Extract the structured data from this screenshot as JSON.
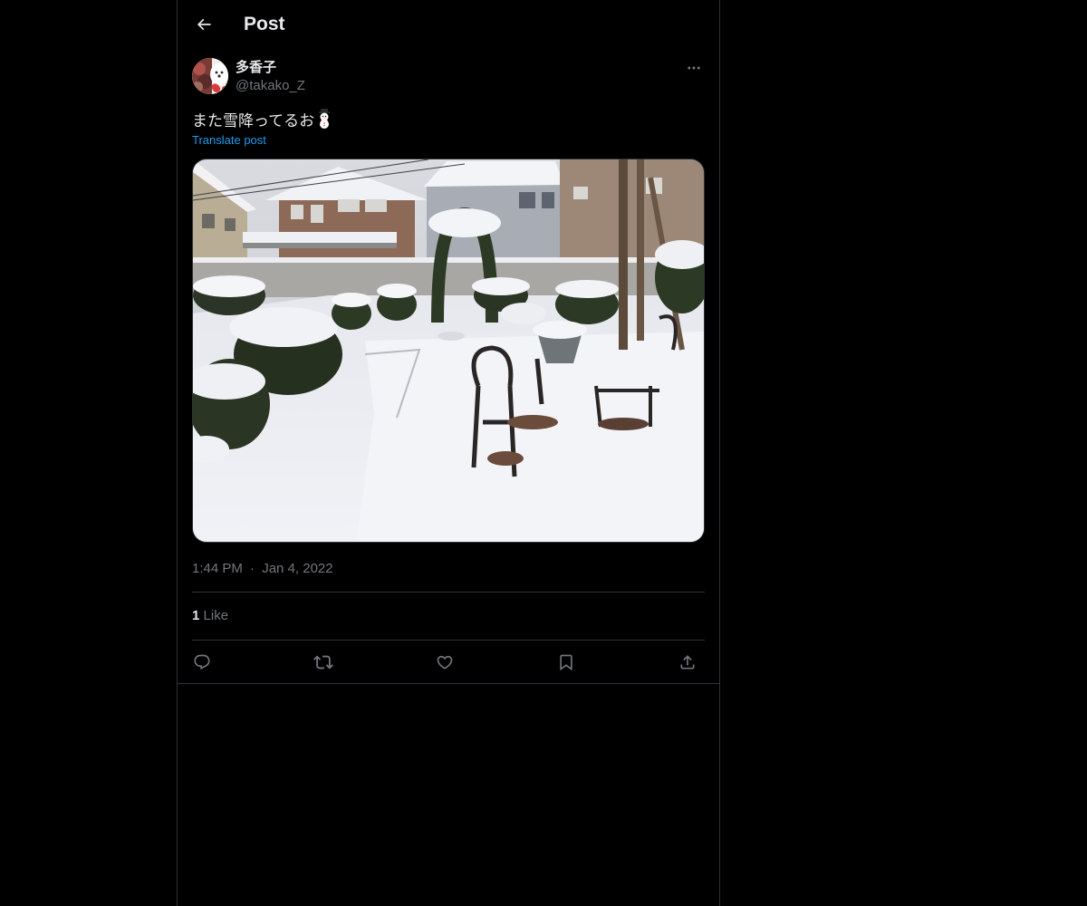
{
  "header": {
    "title": "Post",
    "back_icon": "arrow-left-icon"
  },
  "author": {
    "display_name": "多香子",
    "handle": "@takako_Z",
    "avatar_icon": "avatar-image"
  },
  "post": {
    "text": "また雪降ってるお",
    "emoji": "snowman-icon",
    "translate_label": "Translate post",
    "media_description_icon": "photo-snowy-garden-image",
    "time": "1:44 PM",
    "separator": "·",
    "date": "Jan 4, 2022"
  },
  "stats": {
    "likes_count": "1",
    "likes_label": "Like"
  },
  "actions": {
    "reply_icon": "reply-icon",
    "repost_icon": "repost-icon",
    "like_icon": "heart-icon",
    "bookmark_icon": "bookmark-icon",
    "share_icon": "share-icon"
  },
  "colors": {
    "background": "#000000",
    "text_primary": "#e7e9ea",
    "text_secondary": "#71767b",
    "link": "#1d9bf0",
    "border": "#2f3336"
  }
}
